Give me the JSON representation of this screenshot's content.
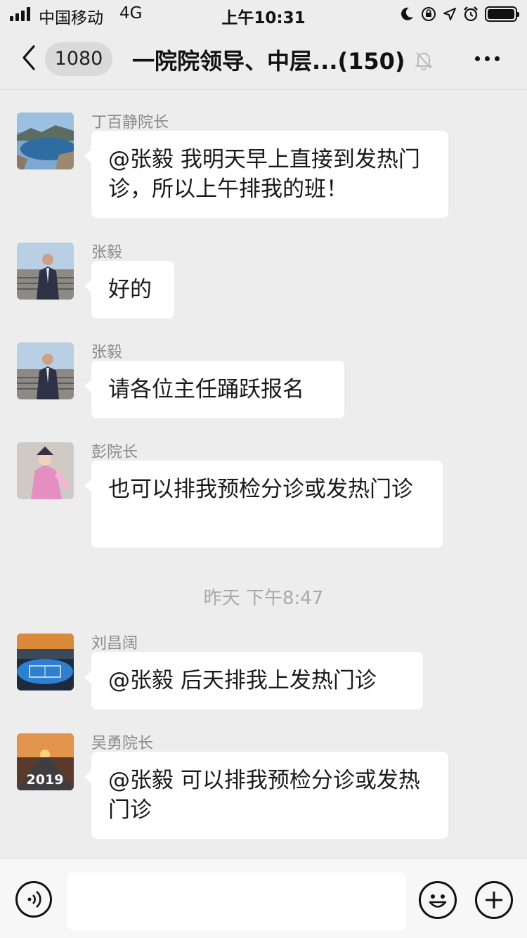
{
  "status_bar": {
    "carrier": "中国移动",
    "network": "4G",
    "time": "上午10:31",
    "icons": [
      "moon-icon",
      "orientation-lock-icon",
      "location-icon",
      "alarm-icon",
      "battery-icon"
    ]
  },
  "nav": {
    "back_icon": "chevron-left-icon",
    "unread_count": "1080",
    "title": "一院院领导、中层...(150)",
    "mute_icon": "bell-off-icon",
    "more_icon": "more-dots-icon"
  },
  "messages": [
    {
      "sender": "丁百静院长",
      "text": "@张毅 我明天早上直接到发热门诊，所以上午排我的班！"
    },
    {
      "sender": "张毅",
      "text": "好的"
    },
    {
      "sender": "张毅",
      "text": "请各位主任踊跃报名"
    },
    {
      "sender": "彭院长",
      "text": "也可以排我预检分诊或发热门诊"
    },
    {
      "sender": "刘昌阔",
      "text": "@张毅 后天排我上发热门诊"
    },
    {
      "sender": "吴勇院长",
      "text": "@张毅 可以排我预检分诊或发热门诊"
    }
  ],
  "timestamp": "昨天 下午8:47",
  "avatar_texts": {
    "wuyong": "2019"
  },
  "input_bar": {
    "voice_icon": "voice-icon",
    "emoji_icon": "emoji-icon",
    "plus_icon": "plus-icon",
    "text_value": ""
  },
  "colors": {
    "background": "#ededed",
    "bubble": "#ffffff",
    "sender_text": "#8a8a8a",
    "timestamp_text": "#aaaaaa"
  }
}
